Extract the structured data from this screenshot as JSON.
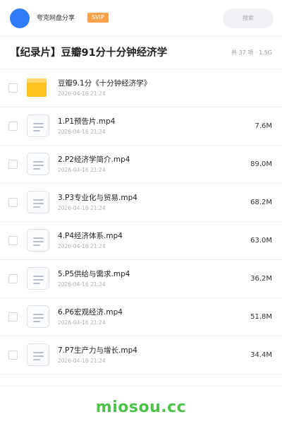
{
  "header": {
    "user_name": "夸克网盘分享",
    "badge": "SVIP",
    "search_placeholder": "搜索"
  },
  "share": {
    "title": "【纪录片】豆瓣91分十分钟经济学",
    "summary": "共 37 项 · 1.5G"
  },
  "files": [
    {
      "type": "folder",
      "name": "豆瓣9.1分《十分钟经济学》",
      "date": "2026-04-16 21:24",
      "size": ""
    },
    {
      "type": "file",
      "name": "1.P1预告片.mp4",
      "date": "2026-04-16 21:24",
      "size": "7.6M"
    },
    {
      "type": "file",
      "name": "2.P2经济学简介.mp4",
      "date": "2026-04-16 21:24",
      "size": "89.0M"
    },
    {
      "type": "file",
      "name": "3.P3专业化与贸易.mp4",
      "date": "2026-04-16 21:24",
      "size": "68.2M"
    },
    {
      "type": "file",
      "name": "4.P4经济体系.mp4",
      "date": "2026-04-16 21:24",
      "size": "63.0M"
    },
    {
      "type": "file",
      "name": "5.P5供给与需求.mp4",
      "date": "2026-04-16 21:24",
      "size": "36.2M"
    },
    {
      "type": "file",
      "name": "6.P6宏观经济.mp4",
      "date": "2026-04-16 21:24",
      "size": "51.8M"
    },
    {
      "type": "file",
      "name": "7.P7生产力与增长.mp4",
      "date": "2026-04-16 21:24",
      "size": "34.4M"
    }
  ],
  "watermark": "miosou.cc",
  "colors": {
    "accent_blue": "#2f7cf6",
    "svip_orange": "#f7a14a",
    "folder_yellow": "#ffc21f",
    "watermark_green": "#4cc24a"
  }
}
